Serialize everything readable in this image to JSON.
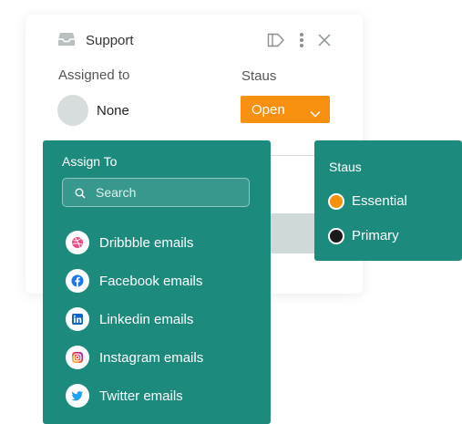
{
  "card": {
    "title": "Support",
    "assigned_label": "Assigned to",
    "status_label": "Staus",
    "assignee": "None",
    "status_value": "Open"
  },
  "assign_dropdown": {
    "title": "Assign To",
    "search_placeholder": "Search",
    "items": [
      {
        "label": "Dribbble emails",
        "icon": "dribbble-icon"
      },
      {
        "label": "Facebook emails",
        "icon": "facebook-icon"
      },
      {
        "label": "Linkedin emails",
        "icon": "linkedin-icon"
      },
      {
        "label": "Instagram emails",
        "icon": "instagram-icon"
      },
      {
        "label": "Twitter emails",
        "icon": "twitter-icon"
      }
    ]
  },
  "status_dropdown": {
    "title": "Staus",
    "options": [
      {
        "label": "Essential",
        "color": "#f7900e"
      },
      {
        "label": "Primary",
        "color": "#1a1a1a"
      }
    ]
  },
  "colors": {
    "accent_orange": "#f7900e",
    "panel_teal": "#1d8a7e"
  }
}
